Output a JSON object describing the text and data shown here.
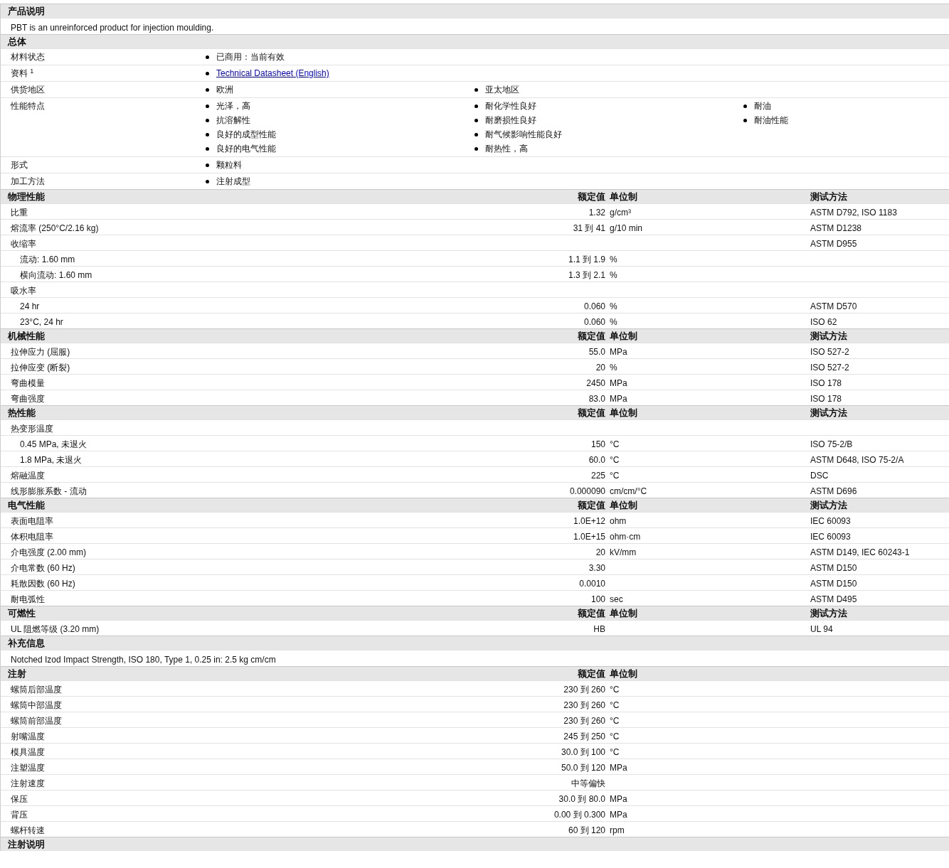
{
  "sections": [
    {
      "kind": "text",
      "title": "产品说明",
      "text": "PBT is an unreinforced product for injection moulding."
    },
    {
      "kind": "bullets",
      "title": "总体",
      "rows": [
        {
          "label": "材料状态",
          "columns": [
            [
              {
                "text": "已商用：当前有效",
                "link": false
              }
            ]
          ]
        },
        {
          "label": "资料 $^{1}$",
          "columns": [
            [
              {
                "text": "Technical Datasheet (English)",
                "link": true
              }
            ]
          ]
        },
        {
          "label": "供货地区",
          "columns": [
            [
              {
                "text": "欧洲",
                "link": false
              }
            ],
            [
              {
                "text": "亚太地区",
                "link": false
              }
            ]
          ]
        },
        {
          "label": "性能特点",
          "columns": [
            [
              {
                "text": "光泽，高",
                "link": false
              },
              {
                "text": "抗溶解性",
                "link": false
              },
              {
                "text": "良好的成型性能",
                "link": false
              },
              {
                "text": "良好的电气性能",
                "link": false
              }
            ],
            [
              {
                "text": "耐化学性良好",
                "link": false
              },
              {
                "text": "耐磨损性良好",
                "link": false
              },
              {
                "text": "耐气候影响性能良好",
                "link": false
              },
              {
                "text": "耐热性，高",
                "link": false
              }
            ],
            [
              {
                "text": "耐油",
                "link": false
              },
              {
                "text": "耐油性能",
                "link": false
              }
            ]
          ]
        },
        {
          "label": "形式",
          "columns": [
            [
              {
                "text": "颗粒料",
                "link": false
              }
            ]
          ]
        },
        {
          "label": "加工方法",
          "columns": [
            [
              {
                "text": "注射成型",
                "link": false
              }
            ]
          ]
        }
      ]
    },
    {
      "kind": "properties",
      "title": "物理性能",
      "columns": [
        "额定值",
        "单位制",
        "测试方法"
      ],
      "rows": [
        {
          "label": "比重",
          "value": "1.32",
          "unit": "g/cm³",
          "method": "ASTM D792, ISO 1183"
        },
        {
          "label": "熔流率 (250°C/2.16 kg)",
          "value": "31 到  41",
          "unit": "g/10 min",
          "method": "ASTM D1238"
        },
        {
          "label": "收缩率",
          "method": "ASTM D955",
          "children": [
            {
              "label": "流动: 1.60 mm",
              "value": "1.1 到  1.9",
              "unit": "%"
            },
            {
              "label": "横向流动: 1.60 mm",
              "value": "1.3 到  2.1",
              "unit": "%"
            }
          ]
        },
        {
          "label": "吸水率",
          "children": [
            {
              "label": "24 hr",
              "value": "0.060",
              "unit": "%",
              "method": "ASTM D570"
            },
            {
              "label": "23°C, 24 hr",
              "value": "0.060",
              "unit": "%",
              "method": "ISO 62"
            }
          ]
        }
      ]
    },
    {
      "kind": "properties",
      "title": "机械性能",
      "columns": [
        "额定值",
        "单位制",
        "测试方法"
      ],
      "rows": [
        {
          "label": "拉伸应力 (屈服)",
          "value": "55.0",
          "unit": "MPa",
          "method": "ISO 527-2"
        },
        {
          "label": "拉伸应变 (断裂)",
          "value": "20",
          "unit": "%",
          "method": "ISO 527-2"
        },
        {
          "label": "弯曲模量",
          "value": "2450",
          "unit": "MPa",
          "method": "ISO 178"
        },
        {
          "label": "弯曲强度",
          "value": "83.0",
          "unit": "MPa",
          "method": "ISO 178"
        }
      ]
    },
    {
      "kind": "properties",
      "title": "热性能",
      "columns": [
        "额定值",
        "单位制",
        "测试方法"
      ],
      "rows": [
        {
          "label": "热变形温度",
          "children": [
            {
              "label": "0.45 MPa, 未退火",
              "value": "150",
              "unit": "°C",
              "method": "ISO 75-2/B"
            },
            {
              "label": "1.8 MPa, 未退火",
              "value": "60.0",
              "unit": "°C",
              "method": "ASTM D648, ISO 75-2/A"
            }
          ]
        },
        {
          "label": "熔融温度",
          "value": "225",
          "unit": "°C",
          "method": "DSC"
        },
        {
          "label": "线形膨胀系数 - 流动",
          "value": "0.000090",
          "unit": "cm/cm/°C",
          "method": "ASTM D696"
        }
      ]
    },
    {
      "kind": "properties",
      "title": "电气性能",
      "columns": [
        "额定值",
        "单位制",
        "测试方法"
      ],
      "rows": [
        {
          "label": "表面电阻率",
          "value": "1.0E+12",
          "unit": "ohm",
          "method": "IEC 60093"
        },
        {
          "label": "体积电阻率",
          "value": "1.0E+15",
          "unit": "ohm·cm",
          "method": "IEC 60093"
        },
        {
          "label": "介电强度 (2.00 mm)",
          "value": "20",
          "unit": "kV/mm",
          "method": "ASTM D149, IEC 60243-1"
        },
        {
          "label": "介电常数 (60 Hz)",
          "value": "3.30",
          "method": "ASTM D150"
        },
        {
          "label": "耗散因数 (60 Hz)",
          "value": "0.0010",
          "method": "ASTM D150"
        },
        {
          "label": "耐电弧性",
          "value": "100",
          "unit": "sec",
          "method": "ASTM D495"
        }
      ]
    },
    {
      "kind": "properties",
      "title": "可燃性",
      "columns": [
        "额定值",
        "单位制",
        "测试方法"
      ],
      "rows": [
        {
          "label": "UL 阻燃等级 (3.20 mm)",
          "value": "HB",
          "method": "UL 94"
        }
      ]
    },
    {
      "kind": "text",
      "title": "补充信息",
      "text": "Notched Izod Impact Strength, ISO 180, Type 1, 0.25 in: 2.5 kg cm/cm"
    },
    {
      "kind": "properties",
      "title": "注射",
      "columns": [
        "额定值",
        "单位制"
      ],
      "rows": [
        {
          "label": "螺筒后部温度",
          "value": "230 到  260",
          "unit": "°C"
        },
        {
          "label": "螺筒中部温度",
          "value": "230 到  260",
          "unit": "°C"
        },
        {
          "label": "螺筒前部温度",
          "value": "230 到  260",
          "unit": "°C"
        },
        {
          "label": "射嘴温度",
          "value": "245 到  250",
          "unit": "°C"
        },
        {
          "label": "模具温度",
          "value": "30.0 到  100",
          "unit": "°C"
        },
        {
          "label": "注塑温度",
          "value": "50.0 到  120",
          "unit": "MPa"
        },
        {
          "label": "注射速度",
          "value": "中等偏快"
        },
        {
          "label": "保压",
          "value": "30.0 到  80.0",
          "unit": "MPa"
        },
        {
          "label": "背压",
          "value": "0.00 到  0.300",
          "unit": "MPa"
        },
        {
          "label": "螺杆转速",
          "value": "60 到  120",
          "unit": "rpm"
        }
      ]
    },
    {
      "kind": "header",
      "title": "注射说明"
    }
  ]
}
